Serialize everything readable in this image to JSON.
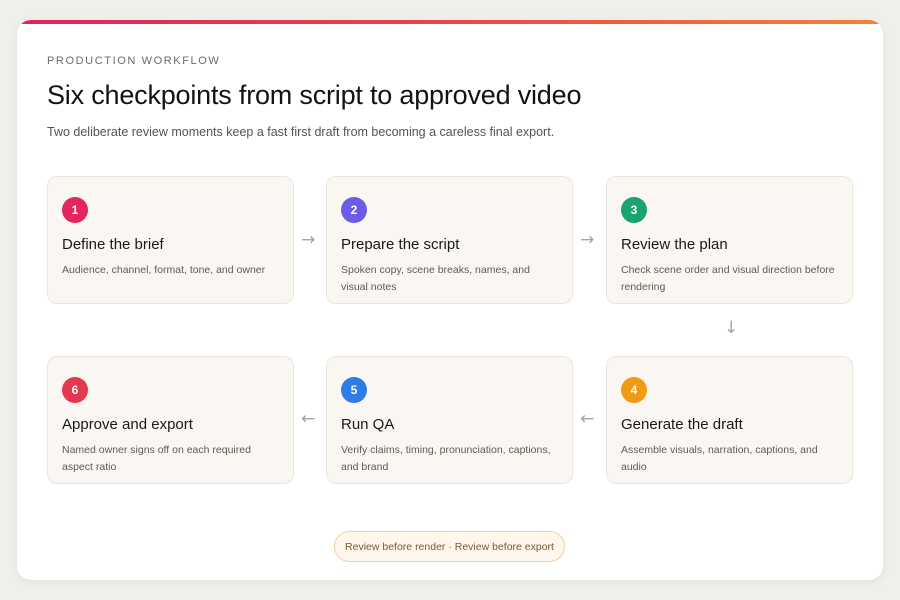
{
  "header": {
    "eyebrow": "PRODUCTION WORKFLOW",
    "title": "Six checkpoints from script to approved video",
    "subtitle": "Two deliberate review moments keep a fast first draft from becoming a careless final export."
  },
  "steps": [
    {
      "number": "1",
      "title": "Define the brief",
      "description": "Audience, channel, format, tone, and owner",
      "color": "#e5255d"
    },
    {
      "number": "2",
      "title": "Prepare the script",
      "description": "Spoken copy, scene breaks, names, and visual notes",
      "color": "#6b5ce7"
    },
    {
      "number": "3",
      "title": "Review the plan",
      "description": "Check scene order and visual direction before rendering",
      "color": "#18a36f"
    },
    {
      "number": "4",
      "title": "Generate the draft",
      "description": "Assemble visuals, narration, captions, and audio",
      "color": "#f19a13"
    },
    {
      "number": "5",
      "title": "Run QA",
      "description": "Verify claims, timing, pronunciation, captions, and brand",
      "color": "#2f7be8"
    },
    {
      "number": "6",
      "title": "Approve and export",
      "description": "Named owner signs off on each required aspect ratio",
      "color": "#e5384f"
    }
  ],
  "footer": {
    "pill": "Review before render · Review before export"
  },
  "icons": {
    "arrow_right": "→",
    "arrow_left": "←",
    "arrow_down": "↓"
  }
}
